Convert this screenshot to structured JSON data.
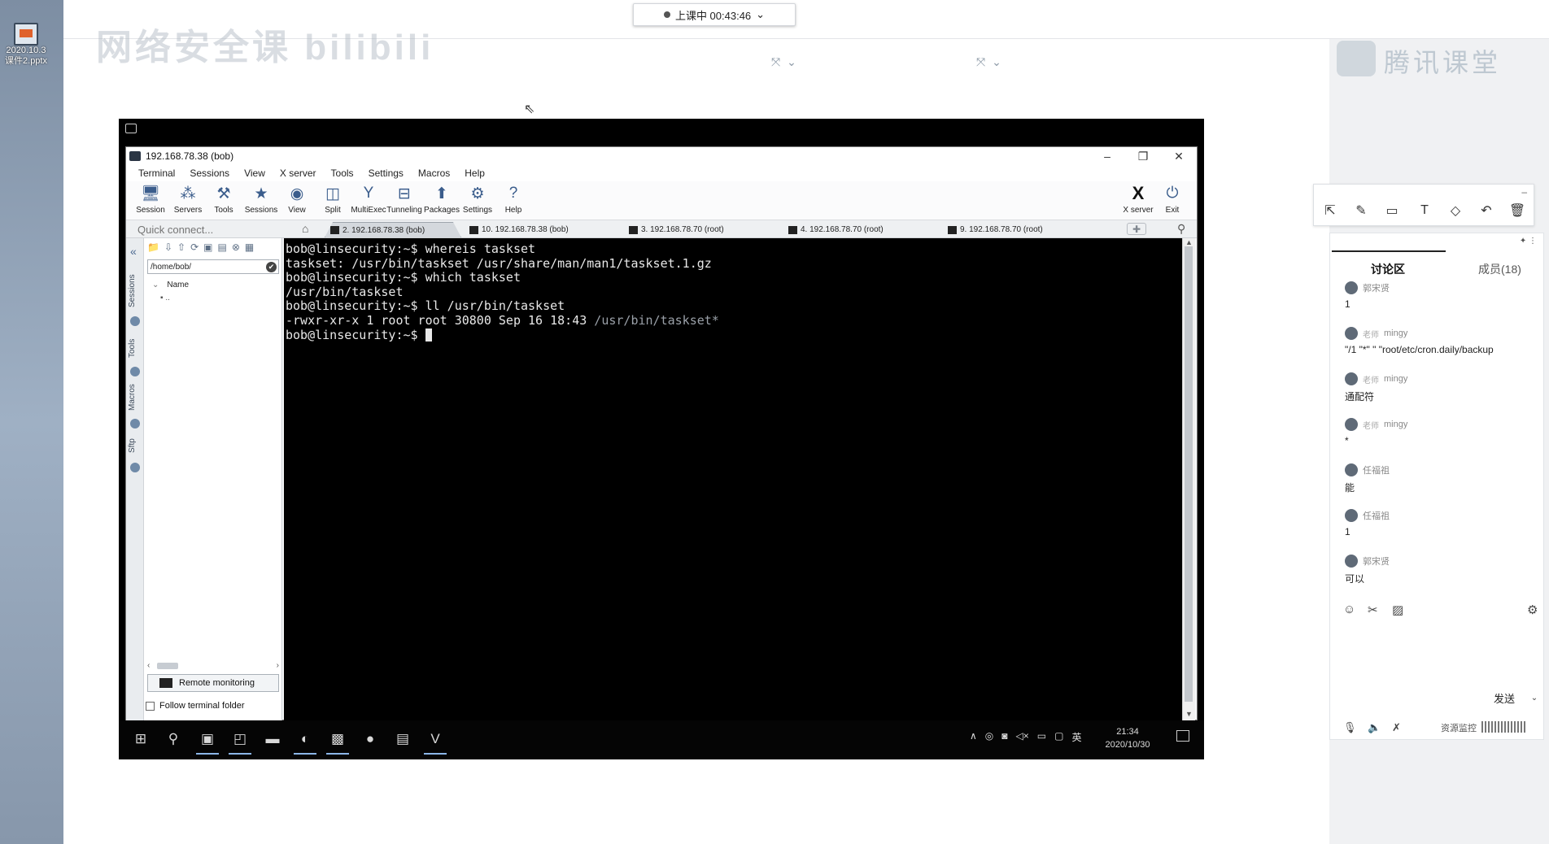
{
  "desktop": {
    "icon_label": "2020.10.3 课件2.pptx"
  },
  "classroom": {
    "status": "上课中 00:43:46",
    "watermark_left": "网络安全课 bilibili",
    "watermark_right": "腾讯课堂",
    "collapse_ctl": "⤧ ⌄"
  },
  "mobaxterm": {
    "title": "192.168.78.38 (bob)",
    "menu": [
      "Terminal",
      "Sessions",
      "View",
      "X server",
      "Tools",
      "Settings",
      "Macros",
      "Help"
    ],
    "toolbar": [
      {
        "label": "Session",
        "icon": "session-icon"
      },
      {
        "label": "Servers",
        "icon": "servers-icon"
      },
      {
        "label": "Tools",
        "icon": "tools-icon"
      },
      {
        "label": "Sessions",
        "icon": "sessions-icon"
      },
      {
        "label": "View",
        "icon": "view-icon"
      },
      {
        "label": "Split",
        "icon": "split-icon"
      },
      {
        "label": "MultiExec",
        "icon": "multiexec-icon"
      },
      {
        "label": "Tunneling",
        "icon": "tunneling-icon"
      },
      {
        "label": "Packages",
        "icon": "packages-icon"
      },
      {
        "label": "Settings",
        "icon": "settings-icon"
      },
      {
        "label": "Help",
        "icon": "help-icon"
      }
    ],
    "toolbar_right": [
      {
        "label": "X server",
        "icon": "xserver-icon"
      },
      {
        "label": "Exit",
        "icon": "exit-icon"
      }
    ],
    "quick_connect_placeholder": "Quick connect...",
    "tabs": [
      {
        "label": "2. 192.168.78.38 (bob)",
        "active": true
      },
      {
        "label": "10. 192.168.78.38 (bob)",
        "active": false
      },
      {
        "label": "3. 192.168.78.70 (root)",
        "active": false
      },
      {
        "label": "4. 192.168.78.70 (root)",
        "active": false
      },
      {
        "label": "9. 192.168.78.70 (root)",
        "active": false
      }
    ],
    "sidebar": {
      "vtabs": [
        "Sessions",
        "Tools",
        "Macros",
        "Sftp"
      ],
      "path": "/home/bob/",
      "column_name": "Name",
      "parent_dir": "..",
      "remote_monitoring": "Remote monitoring",
      "follow_folder": "Follow terminal folder"
    },
    "terminal": {
      "lines": [
        "bob@linsecurity:~$ whereis taskset",
        "taskset: /usr/bin/taskset /usr/share/man/man1/taskset.1.gz",
        "bob@linsecurity:~$ which taskset",
        "/usr/bin/taskset",
        "bob@linsecurity:~$ ll /usr/bin/taskset",
        "-rwxr-xr-x 1 root root 30800 Sep 16 18:43 "
      ],
      "ll_path": "/usr/bin/taskset*",
      "prompt": "bob@linsecurity:~$ "
    }
  },
  "remote_taskbar": {
    "time": "21:34",
    "date": "2020/10/30",
    "ime": "英"
  },
  "annotation_tools": [
    {
      "name": "pointer-tool",
      "glyph": "⇱"
    },
    {
      "name": "pen-tool",
      "glyph": "✎"
    },
    {
      "name": "rectangle-tool",
      "glyph": "▭"
    },
    {
      "name": "text-tool",
      "glyph": "T"
    },
    {
      "name": "eraser-tool",
      "glyph": "◇"
    },
    {
      "name": "undo-tool",
      "glyph": "↶"
    },
    {
      "name": "clear-tool",
      "glyph": "🗑"
    }
  ],
  "discussion": {
    "tab_discuss": "讨论区",
    "tab_members": "成员(18)",
    "messages": [
      {
        "user": "郭宋贤",
        "role": "",
        "text": "1"
      },
      {
        "user": "mingy",
        "role": "老师",
        "text": "\"/1 \"*\" \" \"root/etc/cron.daily/backup"
      },
      {
        "user": "mingy",
        "role": "老师",
        "text": "通配符"
      },
      {
        "user": "mingy",
        "role": "老师",
        "text": "*"
      },
      {
        "user": "任福祖",
        "role": "",
        "text": "能"
      },
      {
        "user": "任福祖",
        "role": "",
        "text": "1"
      },
      {
        "user": "郭宋贤",
        "role": "",
        "text": "可以"
      }
    ],
    "send": "发送",
    "resource_monitor": "资源监控"
  }
}
